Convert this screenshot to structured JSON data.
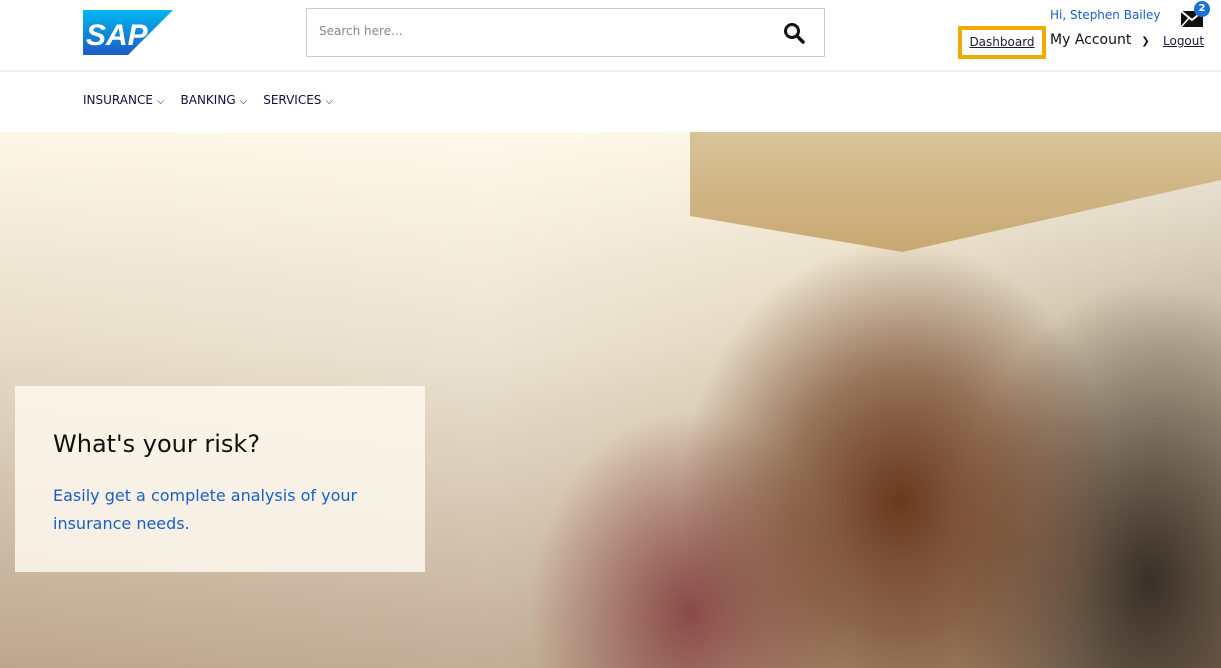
{
  "header": {
    "logo_text": "SAP",
    "search_placeholder": "Search here...",
    "greeting": "Hi, Stephen Bailey",
    "mail_count": "2",
    "dashboard": "Dashboard",
    "my_account": "My Account",
    "logout": "Logout"
  },
  "nav": [
    {
      "label": "INSURANCE"
    },
    {
      "label": "BANKING"
    },
    {
      "label": "SERVICES"
    }
  ],
  "hero": {
    "title": "What's your risk?",
    "subtitle": "Easily get a complete analysis of your insurance needs."
  },
  "colors": {
    "brand": "#1a5fc8",
    "highlight": "#f0ab00"
  }
}
